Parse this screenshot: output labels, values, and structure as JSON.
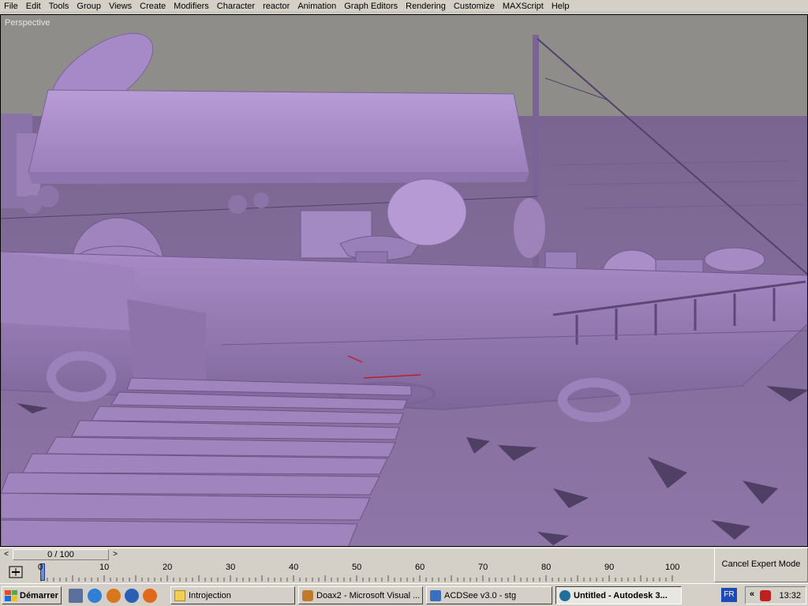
{
  "menubar": {
    "items": [
      "File",
      "Edit",
      "Tools",
      "Group",
      "Views",
      "Create",
      "Modifiers",
      "Character",
      "reactor",
      "Animation",
      "Graph Editors",
      "Rendering",
      "Customize",
      "MAXScript",
      "Help"
    ]
  },
  "viewport": {
    "label": "Perspective",
    "colors": {
      "sky": "#8f8d8a",
      "shade": "#a486c4",
      "dark": "#6b5585",
      "water": "#7e6898"
    }
  },
  "timeslider": {
    "position_label": "0 / 100",
    "current_frame": 0,
    "total_frames": 100
  },
  "trackbar": {
    "ticks": [
      "0",
      "10",
      "20",
      "30",
      "40",
      "50",
      "60",
      "70",
      "80",
      "90",
      "100"
    ]
  },
  "expert_mode": {
    "label": "Cancel Expert Mode"
  },
  "taskbar": {
    "start_label": "Démarrer",
    "tasks": [
      {
        "label": "Introjection",
        "icon": "folder-icon",
        "active": false
      },
      {
        "label": "Doax2 - Microsoft Visual ...",
        "icon": "visual-studio-icon",
        "active": false
      },
      {
        "label": "ACDSee v3.0 - stg",
        "icon": "acdsee-icon",
        "active": false
      },
      {
        "label": "Untitled - Autodesk 3...",
        "icon": "3dsmax-icon",
        "active": true
      }
    ],
    "language": "FR",
    "clock": "13:32"
  }
}
